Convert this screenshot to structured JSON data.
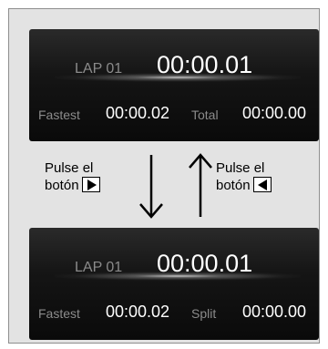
{
  "top_screen": {
    "lap_label": "LAP 01",
    "lap_time": "00:00.01",
    "fastest_label": "Fastest",
    "fastest_value": "00:00.02",
    "right_label": "Total",
    "right_value": "00:00.00"
  },
  "bottom_screen": {
    "lap_label": "LAP 01",
    "lap_time": "00:00.01",
    "fastest_label": "Fastest",
    "fastest_value": "00:00.02",
    "right_label": "Split",
    "right_value": "00:00.00"
  },
  "instruction_left": {
    "line1": "Pulse el",
    "line2": "botón",
    "button_icon": "play-right-triangle-icon"
  },
  "instruction_right": {
    "line1": "Pulse el",
    "line2": "botón",
    "button_icon": "play-left-triangle-icon"
  },
  "colors": {
    "screen_bg": "#121212",
    "frame_bg": "#e3e3e3",
    "dim_text": "#8b8b8b"
  }
}
